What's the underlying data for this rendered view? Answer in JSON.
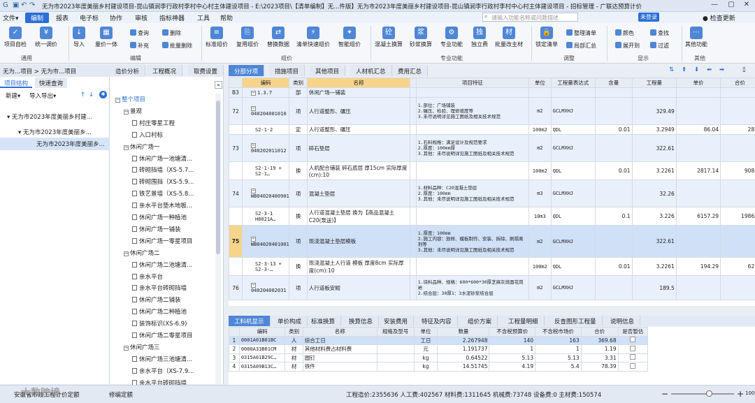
{
  "titlebar": {
    "title": "无为市2023年度美丽乡村建设项目-昆山镇涧李行政村李村中心村主体建设项目 - E:\\2023项目\\【清单编制】无...件版】无为市2023年度美丽乡村建设项目-昆山镇涧李行政村李村中心村主体建设项目 - 招标管理 - 广联达预算计价"
  },
  "menu": {
    "items": [
      "文件▾",
      "编制",
      "报表",
      "电子标",
      "协作",
      "审核",
      "指标神器",
      "工具",
      "帮助"
    ],
    "search_placeholder": "请输入功能名称或问题描述",
    "login": "未登录",
    "check_update": "检查更新"
  },
  "ribbon": {
    "big": [
      "项目自检",
      "统一调价",
      "导入",
      "量价一体",
      "标准组价",
      "复用组价",
      "替换数据",
      "清单快速组价",
      "智能组价",
      "混凝土换算",
      "砂浆换算",
      "专业功能",
      "独立费",
      "批量改主材",
      "锁定清单",
      "其他功能"
    ],
    "small": [
      "查询",
      "删除",
      "补充",
      "批量删除",
      "整理清单",
      "局部汇总",
      "颜色",
      "查找",
      "展开到",
      "过滤"
    ],
    "groups": [
      "通用",
      "编辑",
      "组价",
      "专业功能",
      "调整",
      "显示",
      "其他"
    ]
  },
  "left": {
    "breadcrumb": "无为...项目 > 无为市...项目",
    "tabs": [
      "项目结构",
      "快速查询"
    ],
    "toolbar": [
      "新建▾",
      "导入导出▾"
    ],
    "tree": [
      "无为市2023年度美丽乡村建...",
      "无为市2023年度美丽乡...",
      "无为市2023年度美丽乡..."
    ]
  },
  "tabs": [
    "造价分析",
    "工程概况",
    "取费设置",
    "分部分项",
    "措施项目",
    "其他项目",
    "人材机汇总",
    "费用汇总"
  ],
  "mid": {
    "items": [
      "整个项目",
      "景观",
      "村庄零星工程",
      "入口村标",
      "休闲广场一",
      "休闲广场一池塘清...",
      "砖砌挡墙（XS-5.7...",
      "砖砌围挡（XS-5.9...",
      "铁艺景墙（XS-5.8...",
      "亲水平台垫木地板...",
      "休闲广场一种植池",
      "休闲广场一铺装",
      "休闲广场一零星项目",
      "休闲广场二",
      "休闲广场二池塘清...",
      "亲水平台",
      "亲水平台砖砌挡墙",
      "休闲广场二铺装",
      "休闲广场二种植池",
      "装饰标识(XS-6.9)",
      "休闲广场二零星项目",
      "休闲广场三",
      "休闲广场三池塘清...",
      "亲水平台（XS-7.9...",
      "亲水平台砖砌挡墙"
    ]
  },
  "grid": {
    "headers": [
      "",
      "编码",
      "类别",
      "名称",
      "",
      "项目特征",
      "单位",
      "工程量表达式",
      "含量",
      "工程量",
      "单价",
      "合价"
    ],
    "rows": [
      {
        "no": "B3",
        "code": "1.3.7",
        "cat": "部",
        "name": "休闲广场—铺装",
        "feat": "",
        "unit": "",
        "expr": "",
        "qty": "",
        "amt": "",
        "price": "",
        "total": ""
      },
      {
        "no": "72",
        "code": "040204001010",
        "cat": "项",
        "name": "人行道整形、碾压",
        "feat": "1.部位：广场铺装\n2.碾压、检验、理修坡度等\n3.未尽说明详见施工图纸及相关技术规范",
        "unit": "m2",
        "expr": "GCLMXHJ",
        "qty": "",
        "amt": "329.49",
        "price": "",
        "total": ""
      },
      {
        "no": "",
        "code": "S2-1-2",
        "cat": "定",
        "name": "人行道整形、碾压",
        "feat": "",
        "unit": "100m2",
        "expr": "QDL",
        "qty": "0.01",
        "amt": "3.2949",
        "price": "86.04",
        "total": "283"
      },
      {
        "no": "73",
        "code": "040202011012",
        "cat": "项",
        "name": "碎石垫层",
        "feat": "1.石料规格：满足设计及规范要求\n2.厚度：100mm厚\n3.其他：未尽说明详见施工图纸及相关技术规范",
        "unit": "m2",
        "expr": "GCLMXHJ",
        "qty": "",
        "amt": "322.61",
        "price": "",
        "total": ""
      },
      {
        "no": "",
        "code": "S2-1-19 + S2-1…",
        "cat": "换",
        "name": "人机配合铺装 碎石底层 厚15cm 实际厚度(cm):10",
        "feat": "",
        "unit": "100m2",
        "expr": "QDL",
        "qty": "0.01",
        "amt": "3.2261",
        "price": "2817.14",
        "total": "9088"
      },
      {
        "no": "74",
        "code": "WB040204009012",
        "cat": "项",
        "name": "混凝土垫层",
        "feat": "1.材料品种：C20混凝土垫层\n2.厚度：100mm\n3.其他：未尽说明详见施工图纸及相关技术规范",
        "unit": "m3",
        "expr": "GCLMXHJ",
        "qty": "",
        "amt": "32.26",
        "price": "",
        "total": ""
      },
      {
        "no": "",
        "code": "S2-3-1 H8021A…",
        "cat": "换",
        "name": "人行道混凝土垫层 换为【商品混凝土C20(泵送)】",
        "feat": "",
        "unit": "10m3",
        "expr": "QDL",
        "qty": "0.1",
        "amt": "3.226",
        "price": "6157.29",
        "total": "19863"
      },
      {
        "no": "75",
        "code": "WB040204010012",
        "cat": "项",
        "name": "现浇混凝土垫层模板",
        "feat": "1.厚度：100mm\n2.施工内容：放样、模板制作、安装、拆除、刷隔离剂等\n3.其他：未尽说明详见施工图纸及相关技术规范",
        "unit": "m2",
        "expr": "GCLMXHJ",
        "qty": "",
        "amt": "322.61",
        "price": "",
        "total": ""
      },
      {
        "no": "",
        "code": "S2-3-13 + S2-3-…",
        "cat": "换",
        "name": "现浇混凝土人行道 模板 厚度8cm 实际厚度(cm):10",
        "feat": "",
        "unit": "100m2",
        "expr": "QDL",
        "qty": "0.01",
        "amt": "3.2261",
        "price": "194.29",
        "total": "627"
      },
      {
        "no": "76",
        "code": "040204002031",
        "cat": "项",
        "name": "人行道板安砌",
        "feat": "1.块料品种、规格：600*600*30厚芝麻灰烧面花岗岩\n2.结合层：30厚1：3水泥砂浆结合层",
        "unit": "m2",
        "expr": "GCLMXHJ",
        "qty": "",
        "amt": "189.5",
        "price": "",
        "total": ""
      }
    ]
  },
  "btmtabs": [
    "工料机显示",
    "单价构成",
    "标准换算",
    "换算信息",
    "安装费用",
    "特征及内容",
    "组价方案",
    "工程量明细",
    "反查图形工程量",
    "说明信息"
  ],
  "btm": {
    "headers": [
      "",
      "编码",
      "类别",
      "名称",
      "规格及型号",
      "单位",
      "数量",
      "不含税预算价",
      "不含税市场价",
      "合价",
      "是否暂估"
    ],
    "rows": [
      [
        "1",
        "0001A01B01BC",
        "人",
        "综合工日",
        "",
        "工日",
        "2.267948",
        "140",
        "163",
        "369.68"
      ],
      [
        "2",
        "0000A33B01CM",
        "材",
        "其他材料费占材料费",
        "",
        "元",
        "1.191737",
        "1",
        "1",
        "1.19"
      ],
      [
        "3",
        "0315A01B29C…",
        "材",
        "圆钉",
        "",
        "kg",
        "0.64522",
        "5.13",
        "5.13",
        "3.31"
      ],
      [
        "4",
        "0315A09B13C…",
        "材",
        "铁件",
        "",
        "kg",
        "14.51745",
        "4.19",
        "5.4",
        "78.39"
      ]
    ]
  },
  "status": {
    "left": "安徽省市政工程计价定额",
    "mid": "修编定额",
    "summary": "工程造价:2355636 人工费:402567 材料费:1311645 机械费:73748 设备费:0 主材费:150574",
    "zoom": "100%",
    "watermark": "大数跨境"
  }
}
